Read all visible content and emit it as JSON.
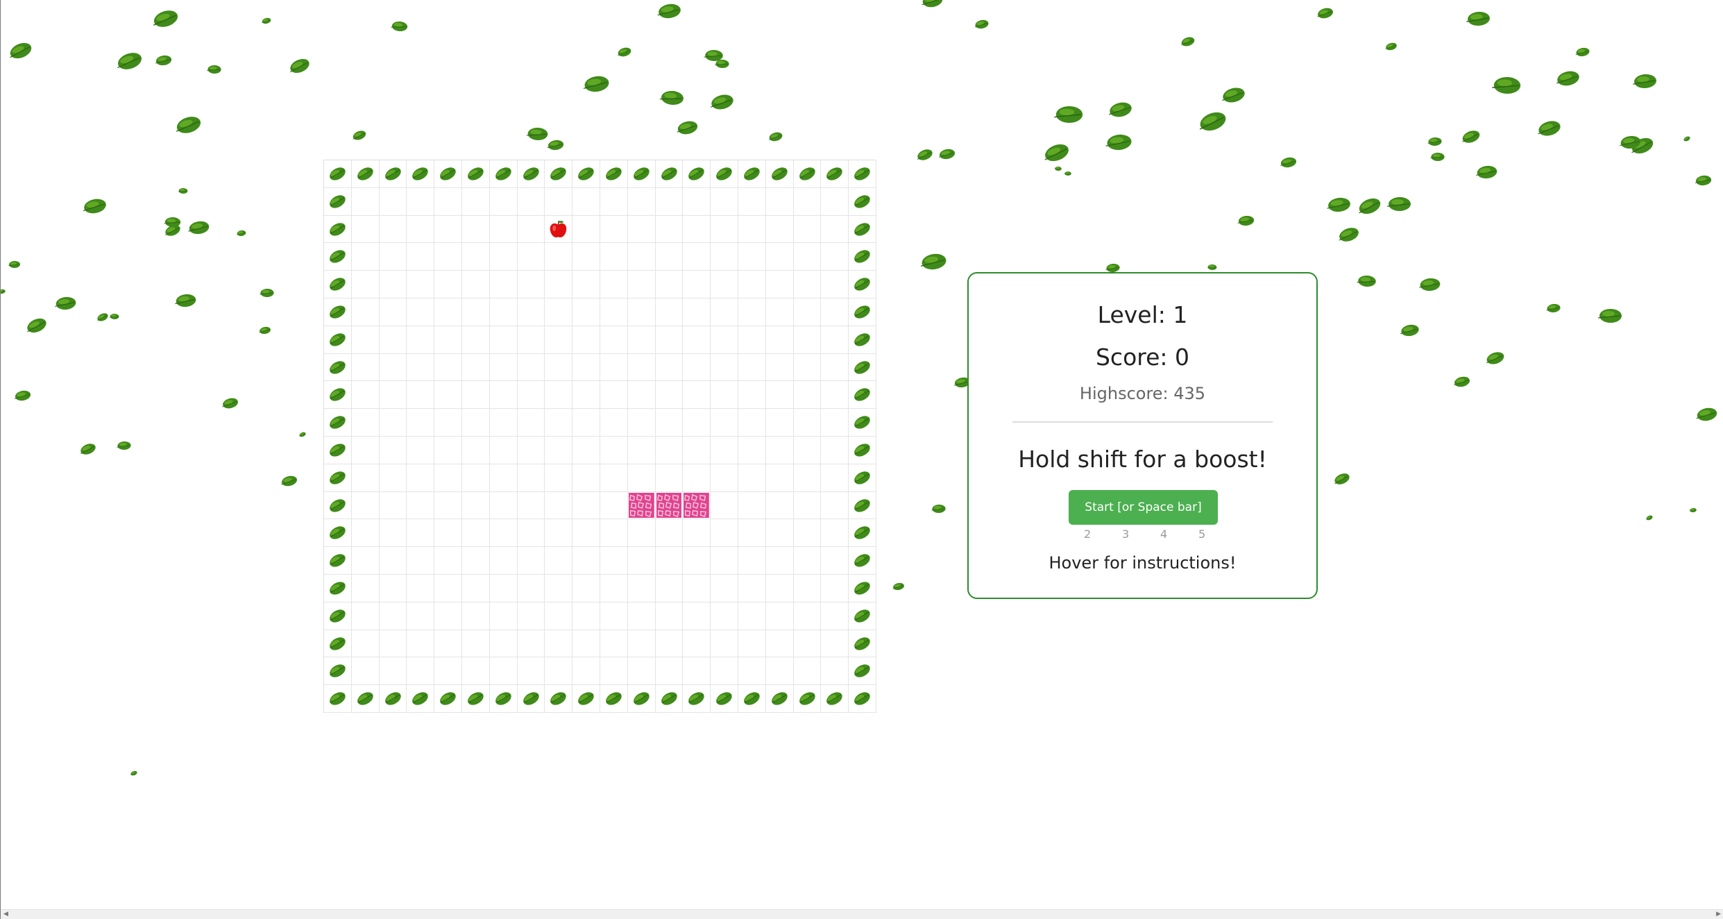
{
  "panel": {
    "level_text": "Level: 1",
    "score_text": "Score: 0",
    "highscore_text": "Highscore: 435",
    "boost_text": "Hold shift for a boost!",
    "start_label": "Start [or Space bar]",
    "level_options": [
      "2",
      "3",
      "4",
      "5"
    ],
    "instructions_text": "Hover for instructions!"
  },
  "game": {
    "grid_size": 20,
    "wall": "border",
    "apple_cell": [
      8,
      2
    ],
    "snake_cells": [
      [
        11,
        12
      ],
      [
        12,
        12
      ],
      [
        13,
        12
      ]
    ],
    "icons": {
      "wall": "leaf-icon",
      "food": "apple-icon",
      "snake": "snake-skin-segment"
    }
  },
  "colors": {
    "accent": "#4caf50",
    "panel_border": "#2e8b2e",
    "leaf": "#3f8a1a",
    "snake": "#e0448f",
    "apple": "#e01010"
  }
}
